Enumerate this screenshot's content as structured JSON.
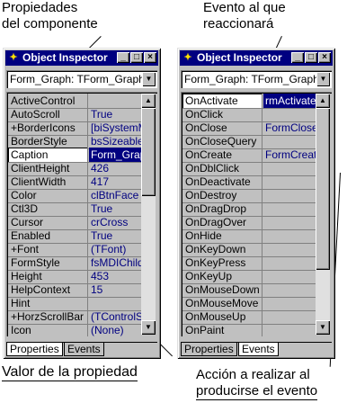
{
  "annotations": {
    "top_left": [
      "Propiedades",
      "del componente"
    ],
    "top_right": [
      "Evento al que",
      "reaccionará"
    ],
    "bottom_left": "Valor de la propiedad",
    "bottom_right": [
      "Acción a realizar al",
      "producirse el evento"
    ]
  },
  "inspector_left": {
    "title": "Object Inspector",
    "combo": "Form_Graph: TForm_Graph",
    "properties": [
      {
        "name": "ActiveControl",
        "value": ""
      },
      {
        "name": "AutoScroll",
        "value": "True"
      },
      {
        "name": "+BorderIcons",
        "value": "[biSystemMenu"
      },
      {
        "name": "BorderStyle",
        "value": "bsSizeable"
      },
      {
        "name": "Caption",
        "value": "Form_Graph"
      },
      {
        "name": "ClientHeight",
        "value": "426"
      },
      {
        "name": "ClientWidth",
        "value": "417"
      },
      {
        "name": "Color",
        "value": "clBtnFace"
      },
      {
        "name": "Ctl3D",
        "value": "True"
      },
      {
        "name": "Cursor",
        "value": "crCross"
      },
      {
        "name": "Enabled",
        "value": "True"
      },
      {
        "name": "+Font",
        "value": "(TFont)"
      },
      {
        "name": "FormStyle",
        "value": "fsMDIChild"
      },
      {
        "name": "Height",
        "value": "453"
      },
      {
        "name": "HelpContext",
        "value": "15"
      },
      {
        "name": "Hint",
        "value": ""
      },
      {
        "name": "+HorzScrollBar",
        "value": "(TControlScroll"
      },
      {
        "name": "Icon",
        "value": "(None)"
      }
    ],
    "tabs": [
      "Properties",
      "Events"
    ]
  },
  "inspector_right": {
    "title": "Object Inspector",
    "combo": "Form_Graph: TForm_Graph",
    "events": [
      {
        "name": "OnActivate",
        "value": "rmActivate"
      },
      {
        "name": "OnClick",
        "value": ""
      },
      {
        "name": "OnClose",
        "value": "FormClose"
      },
      {
        "name": "OnCloseQuery",
        "value": ""
      },
      {
        "name": "OnCreate",
        "value": "FormCreate"
      },
      {
        "name": "OnDblClick",
        "value": ""
      },
      {
        "name": "OnDeactivate",
        "value": ""
      },
      {
        "name": "OnDestroy",
        "value": ""
      },
      {
        "name": "OnDragDrop",
        "value": ""
      },
      {
        "name": "OnDragOver",
        "value": ""
      },
      {
        "name": "OnHide",
        "value": ""
      },
      {
        "name": "OnKeyDown",
        "value": ""
      },
      {
        "name": "OnKeyPress",
        "value": ""
      },
      {
        "name": "OnKeyUp",
        "value": ""
      },
      {
        "name": "OnMouseDown",
        "value": ""
      },
      {
        "name": "OnMouseMove",
        "value": ""
      },
      {
        "name": "OnMouseUp",
        "value": ""
      },
      {
        "name": "OnPaint",
        "value": ""
      }
    ],
    "tabs": [
      "Properties",
      "Events"
    ]
  },
  "colors": {
    "titlebar": "#000080",
    "face": "#c0c0c0",
    "value_text": "#000080"
  }
}
